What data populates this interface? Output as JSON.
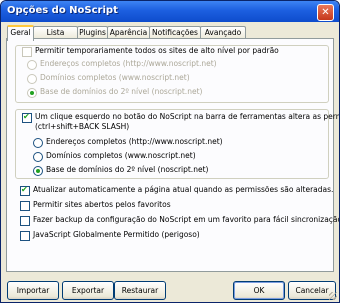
{
  "window": {
    "title": "Opções do NoScript",
    "close_glyph": "✕"
  },
  "tabs": [
    {
      "label": "Geral",
      "active": true
    },
    {
      "label": "Lista Branca"
    },
    {
      "label": "Plugins"
    },
    {
      "label": "Aparência"
    },
    {
      "label": "Notificações"
    },
    {
      "label": "Avançado"
    }
  ],
  "group1": {
    "checkbox_label": "Permitir temporariamente todos os sites de alto nível por padrão",
    "radios": [
      "Endereços completos (http://www.noscript.net)",
      "Domínios completos (www.noscript.net)",
      "Base de domínios do 2º nível (noscript.net)"
    ]
  },
  "group2": {
    "checkbox_label_line1": "Um clique esquerdo no botão do NoScript na barra de ferramentas altera as permissões para o site a",
    "checkbox_label_line2": "(ctrl+shift+BACK SLASH)",
    "radios": [
      "Endereços completos (http://www.noscript.net)",
      "Domínios completos (www.noscript.net)",
      "Base de domínios do 2º nível (noscript.net)"
    ]
  },
  "options": [
    {
      "label": "Atualizar automaticamente a página atual quando as permissões são alteradas.",
      "checked": true
    },
    {
      "label": "Permitir sites abertos pelos favoritos",
      "checked": false
    },
    {
      "label": "Fazer backup da configuração do NoScript em um favorito para fácil sincronização",
      "checked": false
    },
    {
      "label": "JavaScript Globalmente Permitido (perigoso)",
      "checked": false
    }
  ],
  "buttons": {
    "import": "Importar",
    "export": "Exportar",
    "restore": "Restaurar",
    "ok": "OK",
    "cancel": "Cancelar"
  },
  "colors": {
    "titlebar": "#1c5fe0",
    "face": "#ece9d8",
    "check": "#21a121"
  }
}
